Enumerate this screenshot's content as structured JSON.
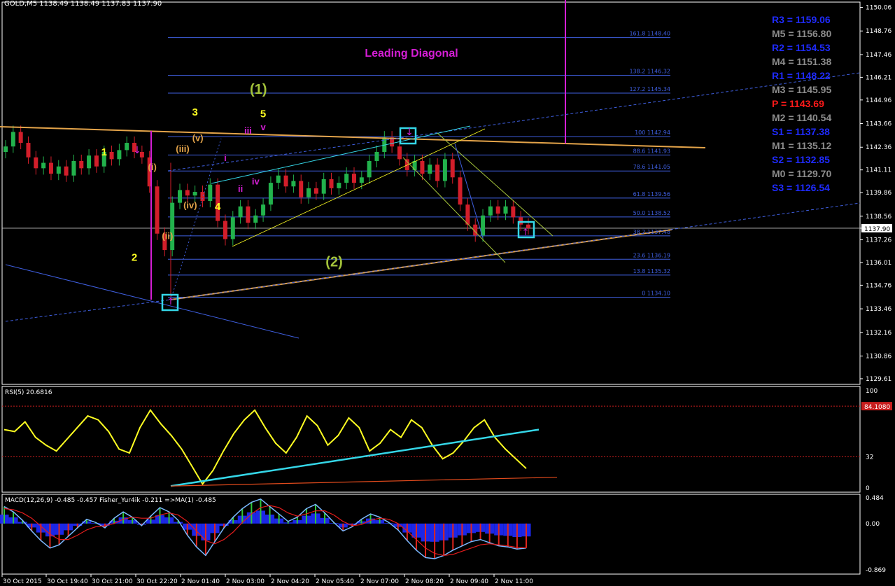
{
  "header": {
    "symbol_label": "GOLD,M5  1138.49 1138.49 1137.83 1137.90"
  },
  "colors": {
    "background": "#000000",
    "grid": "#ffffff",
    "price_panel_border": "#ffffff",
    "fib": "#3f5fe0",
    "orange_trend": "#e4a44a",
    "magenta": "#d51ed5",
    "cyan": "#35d7e8",
    "yellow": "#ffff22",
    "olive": "#a3c23a",
    "bull_candle": "#22b24c",
    "bear_candle": "#d21e2a",
    "rsi_line": "#ffff22",
    "macd_hist_pos": "#2fc73b",
    "macd_hist_neg": "#e1261c",
    "macd_blue": "#1f2bff",
    "macd_signal": "#e41c1c"
  },
  "chart_data": [
    {
      "type": "line",
      "title": "GOLD,M5",
      "subtitle": "1138.49 1138.49 1137.83 1137.90",
      "ylim": [
        1129.3,
        1150.35
      ],
      "y_ticks": [
        "1150.06",
        "1148.76",
        "1147.46",
        "1146.21",
        "1144.96",
        "1143.66",
        "1142.36",
        "1141.11",
        "1139.86",
        "1138.56",
        "1137.90",
        "1137.26",
        "1136.01",
        "1134.76",
        "1133.46",
        "1132.16",
        "1130.86",
        "1129.61"
      ],
      "current_price": "1137.90",
      "title_annotation": "Leading Diagonal",
      "fib_levels": [
        {
          "label": "161.8 1148.40",
          "price": 1148.4
        },
        {
          "label": "138.2 1146.32",
          "price": 1146.32
        },
        {
          "label": "127.2 1145.34",
          "price": 1145.34
        },
        {
          "label": "100 1142.94",
          "price": 1142.94
        },
        {
          "label": "88.6 1141.93",
          "price": 1141.93
        },
        {
          "label": "78.6 1141.05",
          "price": 1141.05
        },
        {
          "label": "61.8 1139.56",
          "price": 1139.56
        },
        {
          "label": "50.0 1138.52",
          "price": 1138.52
        },
        {
          "label": "38.2 1137.48",
          "price": 1137.48
        },
        {
          "label": "23.6 1136.19",
          "price": 1136.19
        },
        {
          "label": "13.8 1135.32",
          "price": 1135.32
        },
        {
          "label": "0 1134.10",
          "price": 1134.1
        }
      ],
      "close_series": [
        1142.4,
        1143.2,
        1142.6,
        1141.8,
        1141.2,
        1141.5,
        1140.9,
        1141.3,
        1140.8,
        1141.6,
        1141.2,
        1141.9,
        1141.3,
        1142.1,
        1141.7,
        1142.2,
        1142.6,
        1142.1,
        1141.8,
        1140.2,
        1137.6,
        1136.7,
        1139.3,
        1140.0,
        1139.7,
        1139.9,
        1139.4,
        1140.3,
        1138.3,
        1137.3,
        1138.5,
        1139.1,
        1138.2,
        1138.6,
        1139.2,
        1140.4,
        1140.8,
        1140.2,
        1140.5,
        1139.6,
        1140.1,
        1139.8,
        1140.6,
        1140.1,
        1140.4,
        1140.9,
        1140.4,
        1140.7,
        1141.6,
        1142.1,
        1142.9,
        1142.4,
        1141.7,
        1141.1,
        1141.6,
        1140.9,
        1141.4,
        1140.5,
        1141.7,
        1140.7,
        1139.2,
        1138.1,
        1137.5,
        1138.6,
        1139.1,
        1138.7,
        1139.1,
        1138.5,
        1138.1,
        1137.9
      ],
      "wave_labels": [
        {
          "text": "1",
          "color": "yellow",
          "price": 1141.9,
          "bar": 13
        },
        {
          "text": "2",
          "color": "yellow",
          "price": 1136.1,
          "bar": 17
        },
        {
          "text": "3",
          "color": "yellow",
          "price": 1144.1,
          "bar": 25
        },
        {
          "text": "4",
          "color": "yellow",
          "price": 1138.9,
          "bar": 28
        },
        {
          "text": "5",
          "color": "yellow",
          "price": 1144.0,
          "bar": 34
        },
        {
          "text": "(1)",
          "color": "olive",
          "price": 1145.3,
          "bar": 33
        },
        {
          "text": "(2)",
          "color": "olive",
          "price": 1135.8,
          "bar": 43
        },
        {
          "text": "(i)",
          "color": "orange",
          "price": 1141.1,
          "bar": 19
        },
        {
          "text": "(ii)",
          "color": "orange",
          "price": 1137.3,
          "bar": 21
        },
        {
          "text": "(iii)",
          "color": "orange",
          "price": 1142.1,
          "bar": 23
        },
        {
          "text": "(iv)",
          "color": "orange",
          "price": 1139.0,
          "bar": 24
        },
        {
          "text": "(v)",
          "color": "orange",
          "price": 1142.7,
          "bar": 25
        },
        {
          "text": "i",
          "color": "magenta",
          "price": 1141.6,
          "bar": 29
        },
        {
          "text": "ii",
          "color": "magenta",
          "price": 1139.9,
          "bar": 31
        },
        {
          "text": "iii",
          "color": "magenta",
          "price": 1143.1,
          "bar": 32
        },
        {
          "text": "iv",
          "color": "magenta",
          "price": 1140.3,
          "bar": 33
        },
        {
          "text": "v",
          "color": "magenta",
          "price": 1143.3,
          "bar": 34
        }
      ]
    },
    {
      "type": "line",
      "title": "RSI(5) 20.6816",
      "ylim": [
        0,
        100
      ],
      "y_ticks": [
        "100",
        "84.1080",
        "32",
        "0"
      ],
      "levels": [
        84.108,
        32
      ],
      "values": [
        60,
        58,
        68,
        52,
        44,
        38,
        50,
        62,
        74,
        70,
        58,
        40,
        36,
        62,
        80,
        66,
        54,
        40,
        22,
        4,
        18,
        38,
        56,
        70,
        80,
        62,
        46,
        36,
        52,
        74,
        64,
        44,
        54,
        72,
        62,
        38,
        46,
        60,
        52,
        70,
        62,
        44,
        30,
        36,
        48,
        62,
        70,
        52,
        40,
        30,
        20
      ]
    },
    {
      "type": "bar",
      "title": "MACD(12,26,9) -0.485 -0.457  Fisher_Yur4ik -0.211  =>MA(1) -0.485",
      "ylim": [
        -0.95,
        0.55
      ],
      "y_ticks": [
        "0.484",
        "0.00",
        "-0.869"
      ],
      "values": [
        0.32,
        0.22,
        0.06,
        -0.14,
        -0.32,
        -0.46,
        -0.4,
        -0.24,
        -0.08,
        0.08,
        0.02,
        -0.08,
        0.1,
        0.22,
        0.12,
        -0.04,
        0.14,
        0.3,
        0.22,
        0.06,
        -0.22,
        -0.44,
        -0.6,
        -0.34,
        -0.08,
        0.12,
        0.28,
        0.4,
        0.46,
        0.32,
        0.18,
        0.04,
        0.12,
        0.28,
        0.36,
        0.2,
        0.02,
        -0.14,
        -0.06,
        0.08,
        0.18,
        0.12,
        0.02,
        -0.12,
        -0.32,
        -0.5,
        -0.64,
        -0.66,
        -0.6,
        -0.5,
        -0.42,
        -0.34,
        -0.3,
        -0.36,
        -0.42,
        -0.44,
        -0.48,
        -0.46
      ],
      "signal": [
        0.28,
        0.26,
        0.2,
        0.1,
        -0.05,
        -0.2,
        -0.3,
        -0.3,
        -0.22,
        -0.12,
        -0.06,
        -0.04,
        0.0,
        0.08,
        0.12,
        0.1,
        0.1,
        0.16,
        0.2,
        0.16,
        0.04,
        -0.14,
        -0.32,
        -0.38,
        -0.3,
        -0.16,
        0.02,
        0.18,
        0.3,
        0.34,
        0.3,
        0.2,
        0.14,
        0.18,
        0.24,
        0.24,
        0.16,
        0.04,
        -0.04,
        -0.02,
        0.06,
        0.1,
        0.08,
        0.0,
        -0.14,
        -0.3,
        -0.46,
        -0.56,
        -0.6,
        -0.58,
        -0.52,
        -0.46,
        -0.4,
        -0.38,
        -0.4,
        -0.42,
        -0.45,
        -0.457
      ],
      "x_ticks": [
        "30 Oct 2015",
        "30 Oct 19:40",
        "30 Oct 21:00",
        "30 Oct 22:20",
        "2 Nov 01:40",
        "2 Nov 03:00",
        "2 Nov 04:20",
        "2 Nov 05:40",
        "2 Nov 07:00",
        "2 Nov 08:20",
        "2 Nov 09:40",
        "2 Nov 11:00"
      ]
    }
  ],
  "pivots": [
    {
      "text": "R3 = 1159.06",
      "color": "#1f2bff"
    },
    {
      "text": "M5 = 1156.80",
      "color": "#8c8c8c"
    },
    {
      "text": "R2 = 1154.53",
      "color": "#1f2bff"
    },
    {
      "text": "M4 = 1151.38",
      "color": "#8c8c8c"
    },
    {
      "text": "R1 = 1148.22",
      "color": "#1f2bff"
    },
    {
      "text": "M3 = 1145.95",
      "color": "#8c8c8c"
    },
    {
      "text": "P   = 1143.69",
      "color": "#ff1a1a"
    },
    {
      "text": "M2 = 1140.54",
      "color": "#8c8c8c"
    },
    {
      "text": "S1 = 1137.38",
      "color": "#1f2bff"
    },
    {
      "text": "M1 = 1135.12",
      "color": "#8c8c8c"
    },
    {
      "text": "S2 = 1132.85",
      "color": "#1f2bff"
    },
    {
      "text": "M0 = 1129.70",
      "color": "#8c8c8c"
    },
    {
      "text": "S3 = 1126.54",
      "color": "#1f2bff"
    }
  ]
}
